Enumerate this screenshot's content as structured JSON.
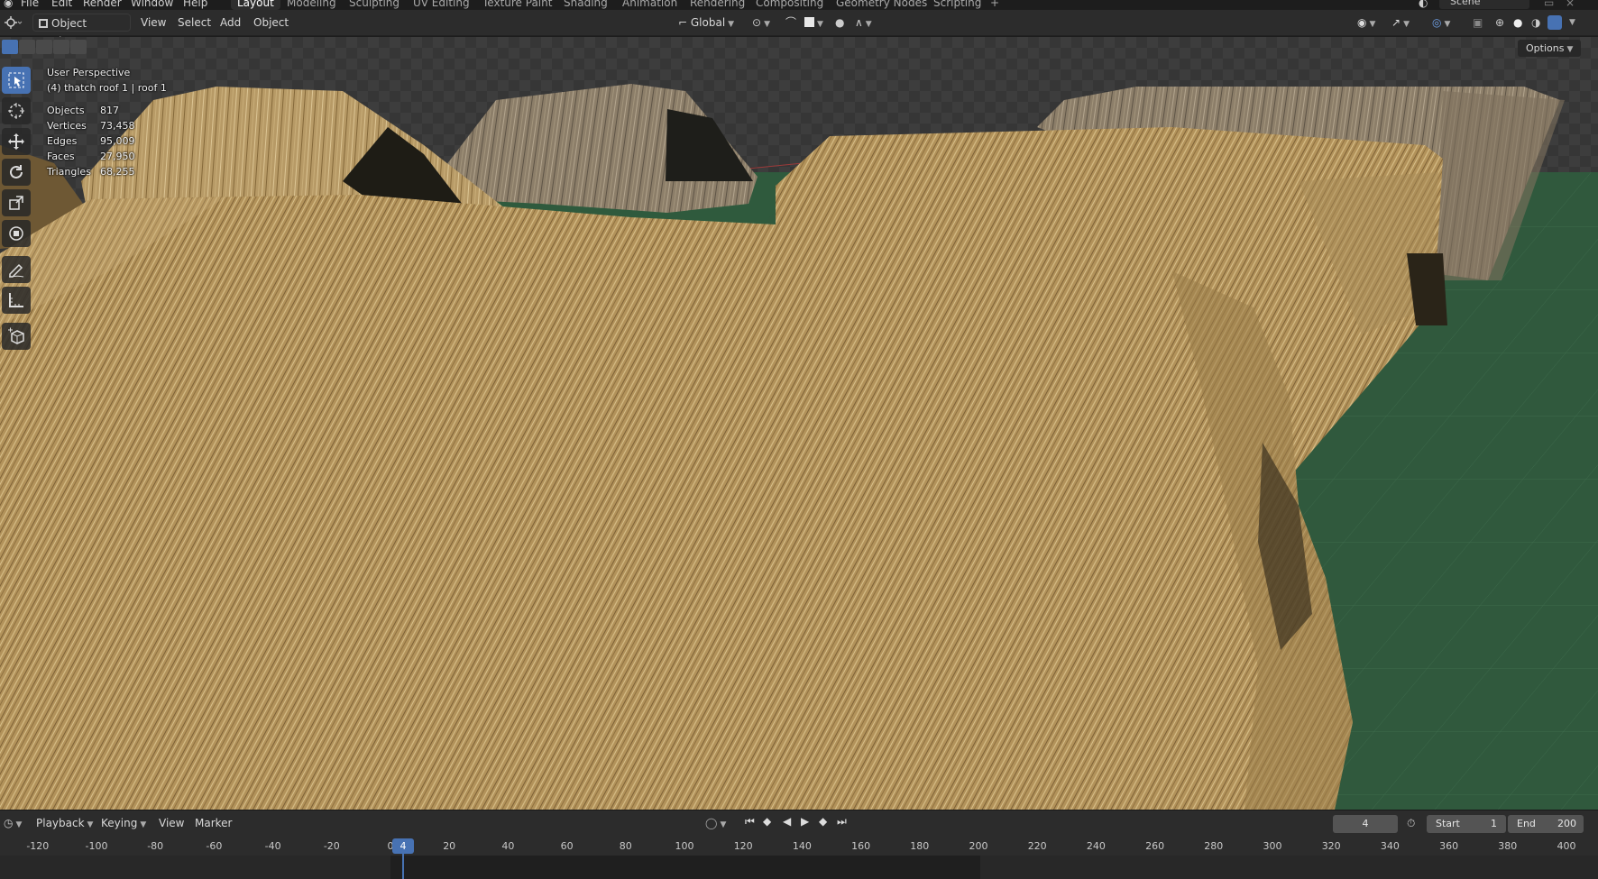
{
  "menu": [
    "File",
    "Edit",
    "Render",
    "Window",
    "Help"
  ],
  "workspaces": [
    {
      "label": "Layout",
      "active": true
    },
    {
      "label": "Modeling",
      "active": false
    },
    {
      "label": "Sculpting",
      "active": false
    },
    {
      "label": "UV Editing",
      "active": false
    },
    {
      "label": "Texture Paint",
      "active": false
    },
    {
      "label": "Shading",
      "active": false
    },
    {
      "label": "Animation",
      "active": false
    },
    {
      "label": "Rendering",
      "active": false
    },
    {
      "label": "Compositing",
      "active": false
    },
    {
      "label": "Geometry Nodes",
      "active": false
    },
    {
      "label": "Scripting",
      "active": false
    }
  ],
  "add_workspace": "+",
  "scene_name": "Scene",
  "header": {
    "mode": "Object Mode",
    "view": "View",
    "select": "Select",
    "add": "Add",
    "object": "Object",
    "transform_orientation": "Global",
    "options": "Options"
  },
  "overlay": {
    "perspective": "User Perspective",
    "object_name": "(4) thatch roof 1 | roof 1",
    "stats": [
      {
        "label": "Objects",
        "value": "817"
      },
      {
        "label": "Vertices",
        "value": "73,458"
      },
      {
        "label": "Edges",
        "value": "95,009"
      },
      {
        "label": "Faces",
        "value": "27,950"
      },
      {
        "label": "Triangles",
        "value": "68,255"
      }
    ]
  },
  "tools": [
    "select-box-icon",
    "cursor-icon",
    "move-icon",
    "rotate-icon",
    "scale-icon",
    "transform-icon",
    "annotate-icon",
    "measure-icon",
    "add-cube-icon"
  ],
  "timeline": {
    "playback": "Playback",
    "keying": "Keying",
    "view": "View",
    "marker": "Marker",
    "current_frame": "4",
    "start_label": "Start",
    "start_value": "1",
    "end_label": "End",
    "end_value": "200",
    "ruler": [
      "-120",
      "-100",
      "-80",
      "-60",
      "-40",
      "-20",
      "0",
      "20",
      "40",
      "60",
      "80",
      "100",
      "120",
      "140",
      "160",
      "180",
      "200",
      "220",
      "240",
      "260",
      "280",
      "300",
      "320",
      "340",
      "360",
      "380",
      "400"
    ]
  },
  "colors": {
    "accent": "#4772b3",
    "thatch": "#b8985f",
    "ground": "#2f5a3d"
  }
}
